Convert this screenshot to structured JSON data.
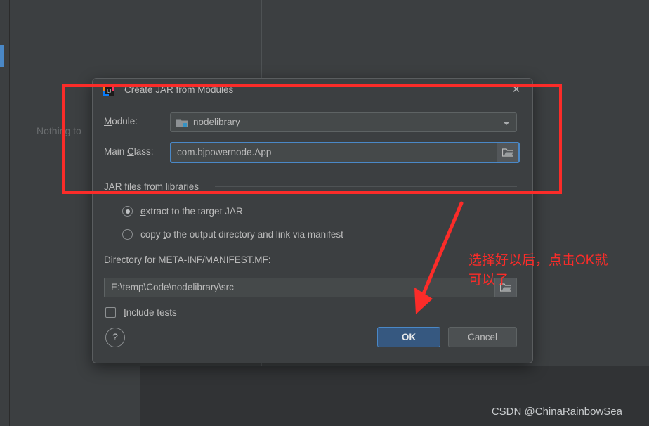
{
  "ide": {
    "empty_editor_text": "Nothing to",
    "watermark": "CSDN @ChinaRainbowSea"
  },
  "dialog": {
    "title": "Create JAR from Modules",
    "icon": "intellij-idea-icon",
    "close_label": "✕",
    "module": {
      "label": "Module:",
      "label_mnemonic": "M",
      "label_rest": "odule:",
      "value": "nodelibrary",
      "icon": "module-folder-icon",
      "dropdown_icon": "chevron-down-icon"
    },
    "main_class": {
      "label_prefix": "Main ",
      "label_mnemonic": "C",
      "label_rest": "lass:",
      "value": "com.bjpowernode.App",
      "browse_icon": "folder-browse-icon"
    },
    "group": {
      "label": "JAR files from libraries"
    },
    "radios": [
      {
        "label_mnemonic": "e",
        "label_rest": "xtract to the target JAR",
        "label_prefix": "",
        "selected": true,
        "name": "extract-to-target-jar"
      },
      {
        "label_prefix": "copy ",
        "label_mnemonic": "t",
        "label_rest": "o the output directory and link via manifest",
        "selected": false,
        "name": "copy-to-output-directory"
      }
    ],
    "directory": {
      "label_mnemonic": "D",
      "label_rest": "irectory for META-INF/MANIFEST.MF:",
      "value": "E:\\temp\\Code\\nodelibrary\\src",
      "browse_icon": "folder-browse-icon"
    },
    "include_tests": {
      "label_mnemonic": "I",
      "label_rest": "nclude tests",
      "checked": false
    },
    "footer": {
      "help_label": "?",
      "ok_label": "OK",
      "cancel_label": "Cancel"
    }
  },
  "annotations": {
    "note_text": "选择好以后，点击OK就\n可以了",
    "accent_color": "#fb2c29"
  }
}
